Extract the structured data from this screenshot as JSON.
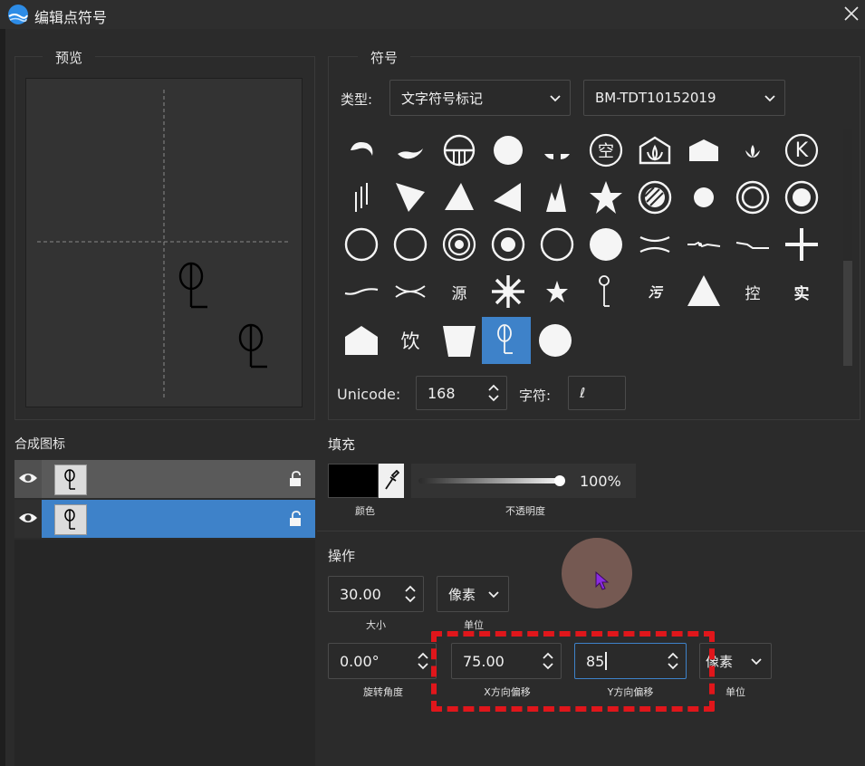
{
  "window": {
    "title": "编辑点符号"
  },
  "preview": {
    "group_title": "预览"
  },
  "symbol": {
    "group_title": "符号",
    "type_label": "类型:",
    "type_value": "文字符号标记",
    "library_value": "BM-TDT10152019",
    "unicode_label": "Unicode:",
    "unicode_value": "168",
    "char_label": "字符:",
    "char_value": "ℓ",
    "grid_texts": {
      "kong": "空",
      "k": "K",
      "yuan": "源",
      "wu": "污",
      "kong2": "控",
      "shi": "实",
      "yin": "饮"
    }
  },
  "composite": {
    "title": "合成图标"
  },
  "fill": {
    "title": "填充",
    "color_label": "颜色",
    "opacity_label": "不透明度",
    "opacity_value": "100%",
    "opacity_fraction": 1.0,
    "color": "#000000"
  },
  "ops": {
    "title": "操作",
    "size_value": "30.00",
    "size_label": "大小",
    "unit_value": "像素",
    "unit_label": "单位",
    "rotation_value": "0.00°",
    "rotation_label": "旋转角度",
    "x_offset_value": "75.00",
    "x_offset_label": "X方向偏移",
    "y_offset_value": "85",
    "y_offset_label": "Y方向偏移",
    "unit2_value": "像素",
    "unit2_label": "单位"
  },
  "colors": {
    "accent": "#3e82c9",
    "highlight_red": "#e0161b"
  }
}
